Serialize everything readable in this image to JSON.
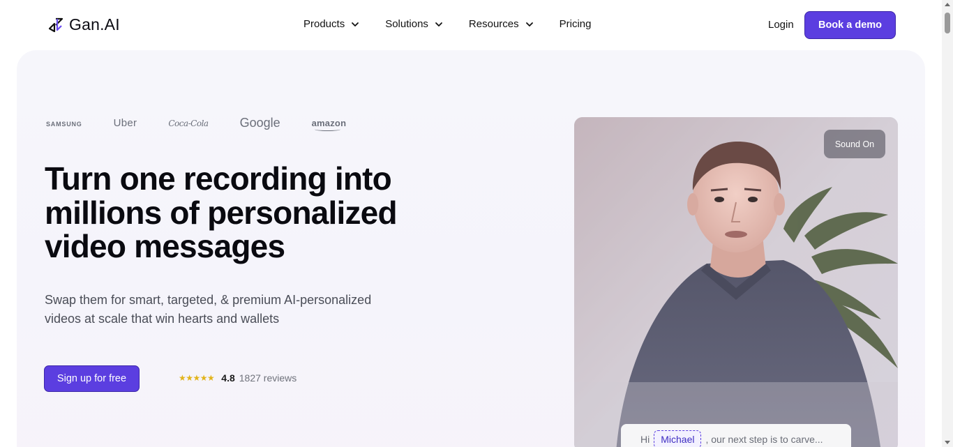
{
  "nav": {
    "logo_text": "Gan.AI",
    "menu": [
      {
        "label": "Products",
        "has_dropdown": true
      },
      {
        "label": "Solutions",
        "has_dropdown": true
      },
      {
        "label": "Resources",
        "has_dropdown": true
      },
      {
        "label": "Pricing",
        "has_dropdown": false
      }
    ],
    "login_label": "Login",
    "demo_label": "Book a demo"
  },
  "hero": {
    "brands": [
      "SAMSUNG",
      "Uber",
      "Coca-Cola",
      "Google",
      "amazon"
    ],
    "headline": "Turn one recording into millions of personalized video messages",
    "subhead": "Swap them for smart, targeted, & premium AI-personalized videos at scale that win hearts and wallets",
    "signup_label": "Sign up for free",
    "rating": {
      "stars": 5,
      "score": "4.8",
      "reviews": "1827 reviews"
    }
  },
  "video": {
    "sound_label": "Sound On",
    "caption": {
      "prefix": "Hi",
      "name": "Michael",
      "suffix": ", our next step is to carve..."
    }
  },
  "colors": {
    "accent": "#5b3ee0",
    "star": "#e2b41b",
    "text": "#0a0a10",
    "muted": "#6f727b"
  },
  "icons": [
    "gan-ai-logo-icon",
    "chevron-down-icon",
    "star-icon"
  ]
}
